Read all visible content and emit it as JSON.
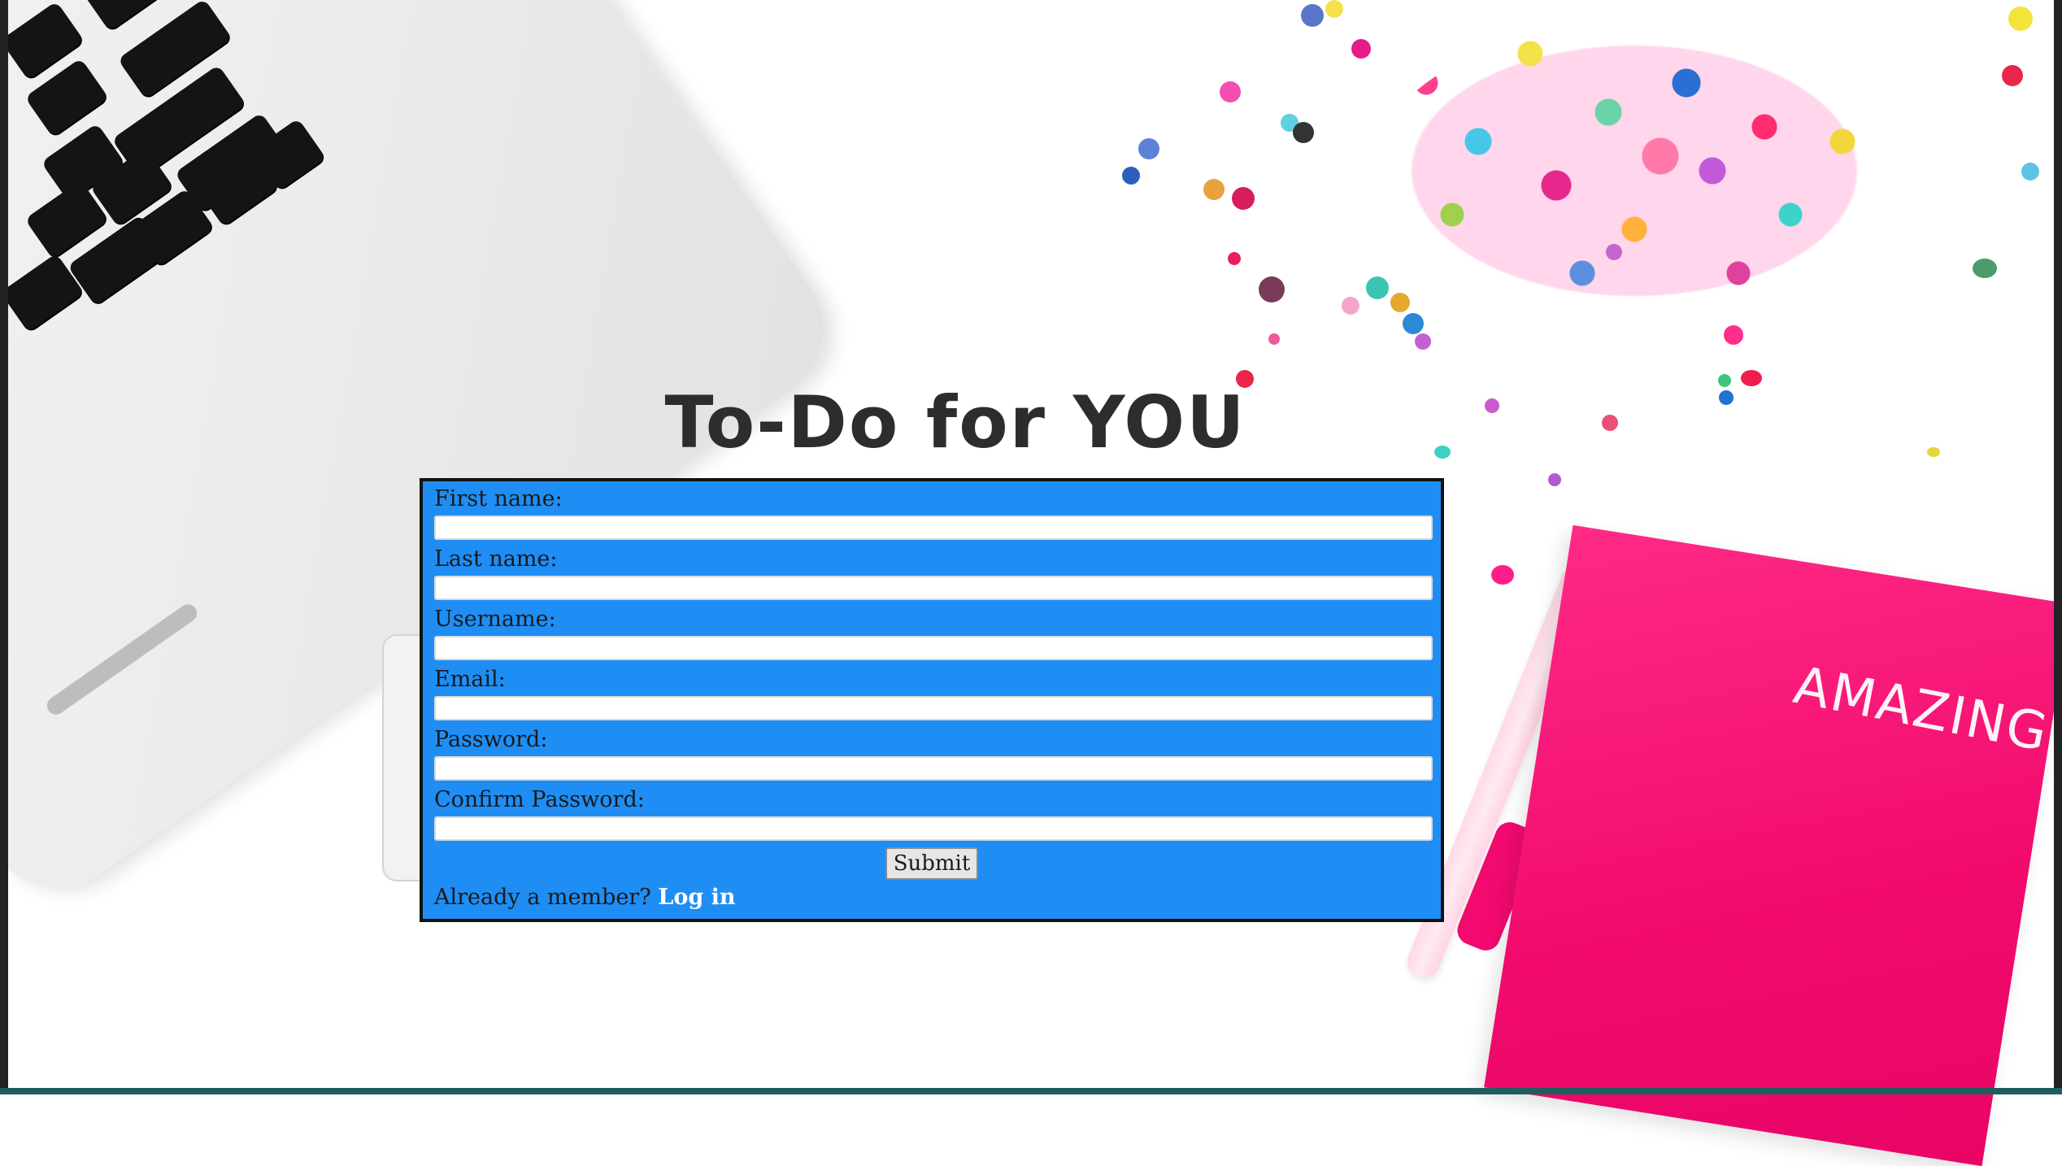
{
  "page": {
    "title": "To-Do for YOU",
    "background_decor_text": "AMAZING"
  },
  "form": {
    "fields": [
      {
        "label": "First name:",
        "value": "",
        "placeholder": ""
      },
      {
        "label": "Last name:",
        "value": "",
        "placeholder": ""
      },
      {
        "label": "Username:",
        "value": "",
        "placeholder": ""
      },
      {
        "label": "Email:",
        "value": "",
        "placeholder": ""
      },
      {
        "label": "Password:",
        "value": "",
        "placeholder": ""
      },
      {
        "label": "Confirm Password:",
        "value": "",
        "placeholder": ""
      }
    ],
    "submit_label": "Submit",
    "member_prompt": "Already a member?",
    "login_link": "Log in"
  },
  "colors": {
    "panel": "#1e8ef5",
    "panel_border": "#111111",
    "title": "#2d2d2d",
    "link": "#ffffff"
  }
}
